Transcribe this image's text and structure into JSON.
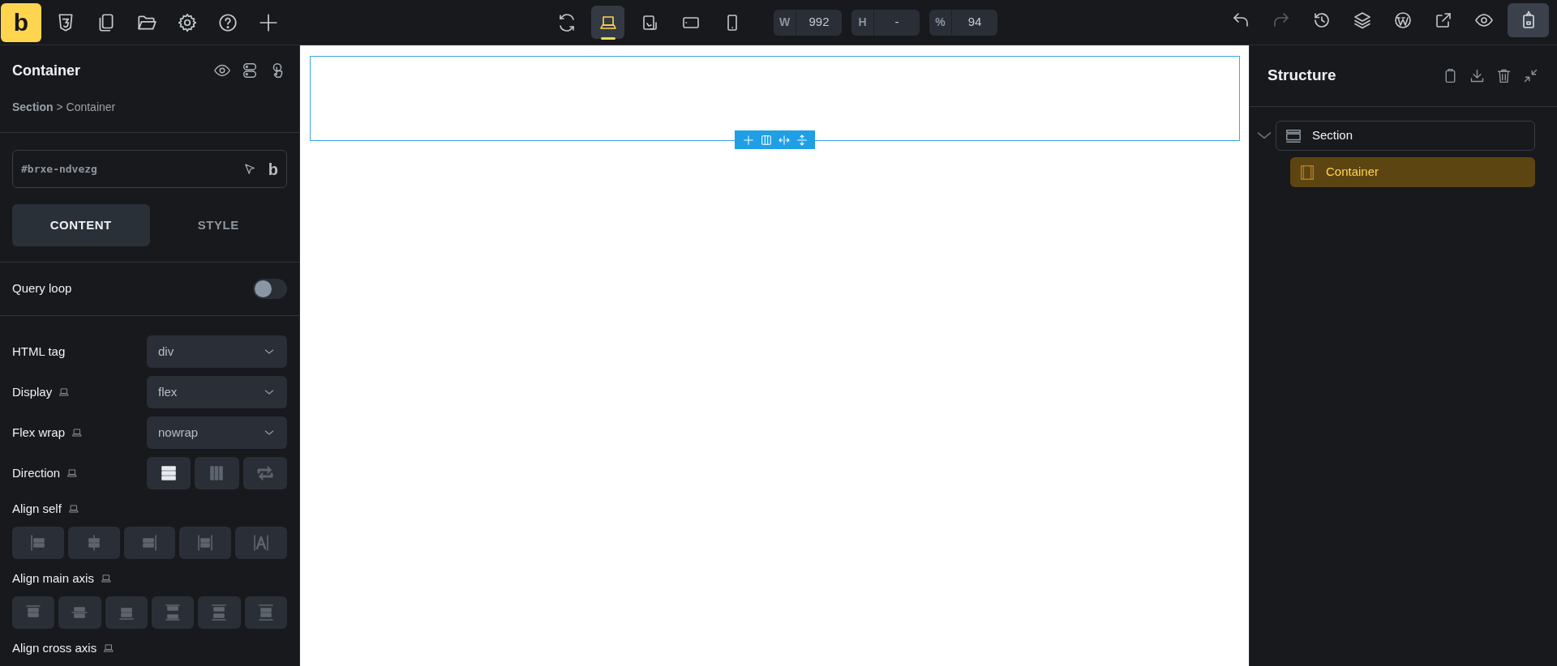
{
  "top_bar": {
    "logo": "b",
    "devices": [
      {
        "selected": true
      },
      {
        "selected": false
      },
      {
        "selected": false
      },
      {
        "selected": false
      }
    ],
    "viewport_fields": [
      {
        "label": "W",
        "value": "992"
      },
      {
        "label": "H",
        "value": "-"
      },
      {
        "label": "%",
        "value": "94"
      }
    ],
    "right_tools": [
      {
        "selected": false
      },
      {
        "selected": false,
        "disabled": true
      },
      {
        "selected": false
      },
      {
        "selected": false
      },
      {
        "selected": false
      },
      {
        "selected": false
      },
      {
        "selected": false
      },
      {
        "selected": true
      }
    ]
  },
  "element_panel": {
    "title": "Container",
    "breadcrumb": "**Section** > Container",
    "element_id": "#brxe-ndvezg",
    "id_badge": "b",
    "tabs": [
      {
        "label": "CONTENT",
        "selected": true
      },
      {
        "label": "STYLE",
        "selected": false
      }
    ],
    "query_loop": {
      "label": "Query loop",
      "on": false
    },
    "controls": [
      {
        "kind": "select",
        "label": "HTML tag",
        "value": "div",
        "responsive": false
      },
      {
        "kind": "select",
        "label": "Display",
        "value": "flex",
        "responsive": true
      },
      {
        "kind": "select",
        "label": "Flex wrap",
        "value": "nowrap",
        "responsive": true
      },
      {
        "kind": "direction",
        "label": "Direction",
        "responsive": true,
        "options": [
          {
            "selected": true
          },
          {
            "selected": false
          },
          {
            "selected": false
          }
        ]
      },
      {
        "kind": "align_self",
        "label": "Align self",
        "responsive": true,
        "options": [
          {
            "selected": false
          },
          {
            "selected": false
          },
          {
            "selected": false
          },
          {
            "selected": false
          },
          {
            "selected": false
          }
        ]
      },
      {
        "kind": "align_main",
        "label": "Align main axis",
        "responsive": true,
        "options": [
          {
            "selected": false
          },
          {
            "selected": false
          },
          {
            "selected": false
          },
          {
            "selected": false
          },
          {
            "selected": false
          },
          {
            "selected": false
          }
        ]
      },
      {
        "kind": "label_only",
        "label": "Align cross axis",
        "responsive": true
      }
    ]
  },
  "structure_panel": {
    "title": "Structure",
    "tree": [
      {
        "label": "Section",
        "kind": "section",
        "expanded": true,
        "selected": false,
        "children": [
          {
            "label": "Container",
            "kind": "container",
            "selected": true
          }
        ]
      }
    ]
  }
}
